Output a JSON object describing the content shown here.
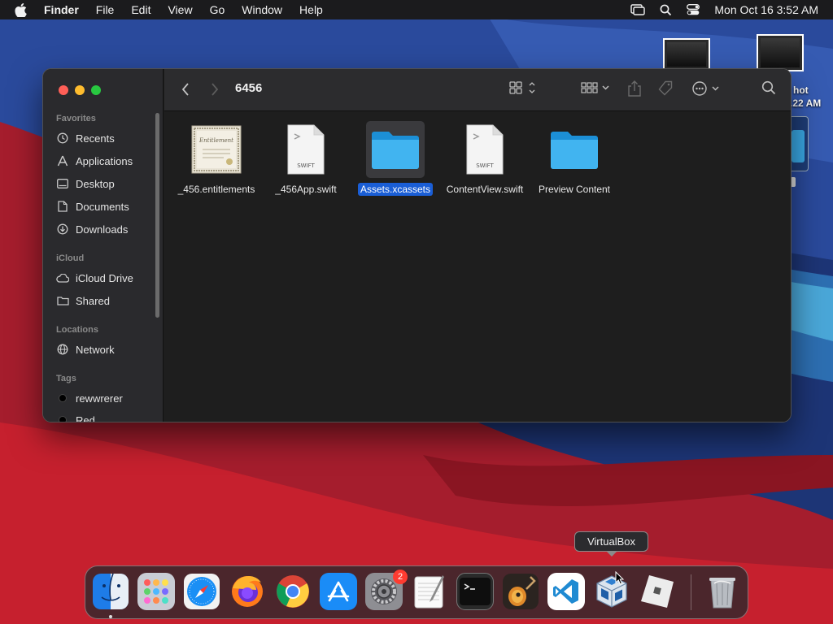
{
  "menubar": {
    "app_name": "Finder",
    "menus": [
      "File",
      "Edit",
      "View",
      "Go",
      "Window",
      "Help"
    ],
    "clock": "Mon Oct 16  3:52 AM"
  },
  "desktop": {
    "label_line1": "hot",
    "label_line2": ".22 AM"
  },
  "finder": {
    "title": "6456",
    "sidebar": {
      "favorites_label": "Favorites",
      "favorites": [
        {
          "label": "Recents",
          "icon": "clock-icon"
        },
        {
          "label": "Applications",
          "icon": "applications-icon"
        },
        {
          "label": "Desktop",
          "icon": "desktop-icon"
        },
        {
          "label": "Documents",
          "icon": "document-icon"
        },
        {
          "label": "Downloads",
          "icon": "download-icon"
        }
      ],
      "icloud_label": "iCloud",
      "icloud": [
        {
          "label": "iCloud Drive",
          "icon": "cloud-icon"
        },
        {
          "label": "Shared",
          "icon": "shared-folder-icon"
        }
      ],
      "locations_label": "Locations",
      "locations": [
        {
          "label": "Network",
          "icon": "globe-icon"
        }
      ],
      "tags_label": "Tags",
      "tags": [
        {
          "label": "rewwrerer",
          "color": "#000000"
        },
        {
          "label": "Red",
          "color": "#000000"
        }
      ]
    },
    "files": [
      {
        "name": "_456.entitlements",
        "kind": "certificate-icon",
        "selected": false
      },
      {
        "name": "_456App.swift",
        "kind": "swift-file-icon",
        "selected": false,
        "badge": "SWIFT"
      },
      {
        "name": "Assets.xcassets",
        "kind": "folder-icon",
        "selected": true
      },
      {
        "name": "ContentView.swift",
        "kind": "swift-file-icon",
        "selected": false,
        "badge": "SWIFT"
      },
      {
        "name": "Preview Content",
        "kind": "folder-icon",
        "selected": false
      }
    ]
  },
  "dock": {
    "tooltip": "VirtualBox",
    "settings_badge": "2",
    "apps": [
      "Finder",
      "Launchpad",
      "Safari",
      "Firefox",
      "Chrome",
      "App Store",
      "System Preferences",
      "TextEdit",
      "Terminal",
      "GarageBand",
      "Visual Studio Code",
      "VirtualBox",
      "Roblox",
      "Trash"
    ]
  }
}
